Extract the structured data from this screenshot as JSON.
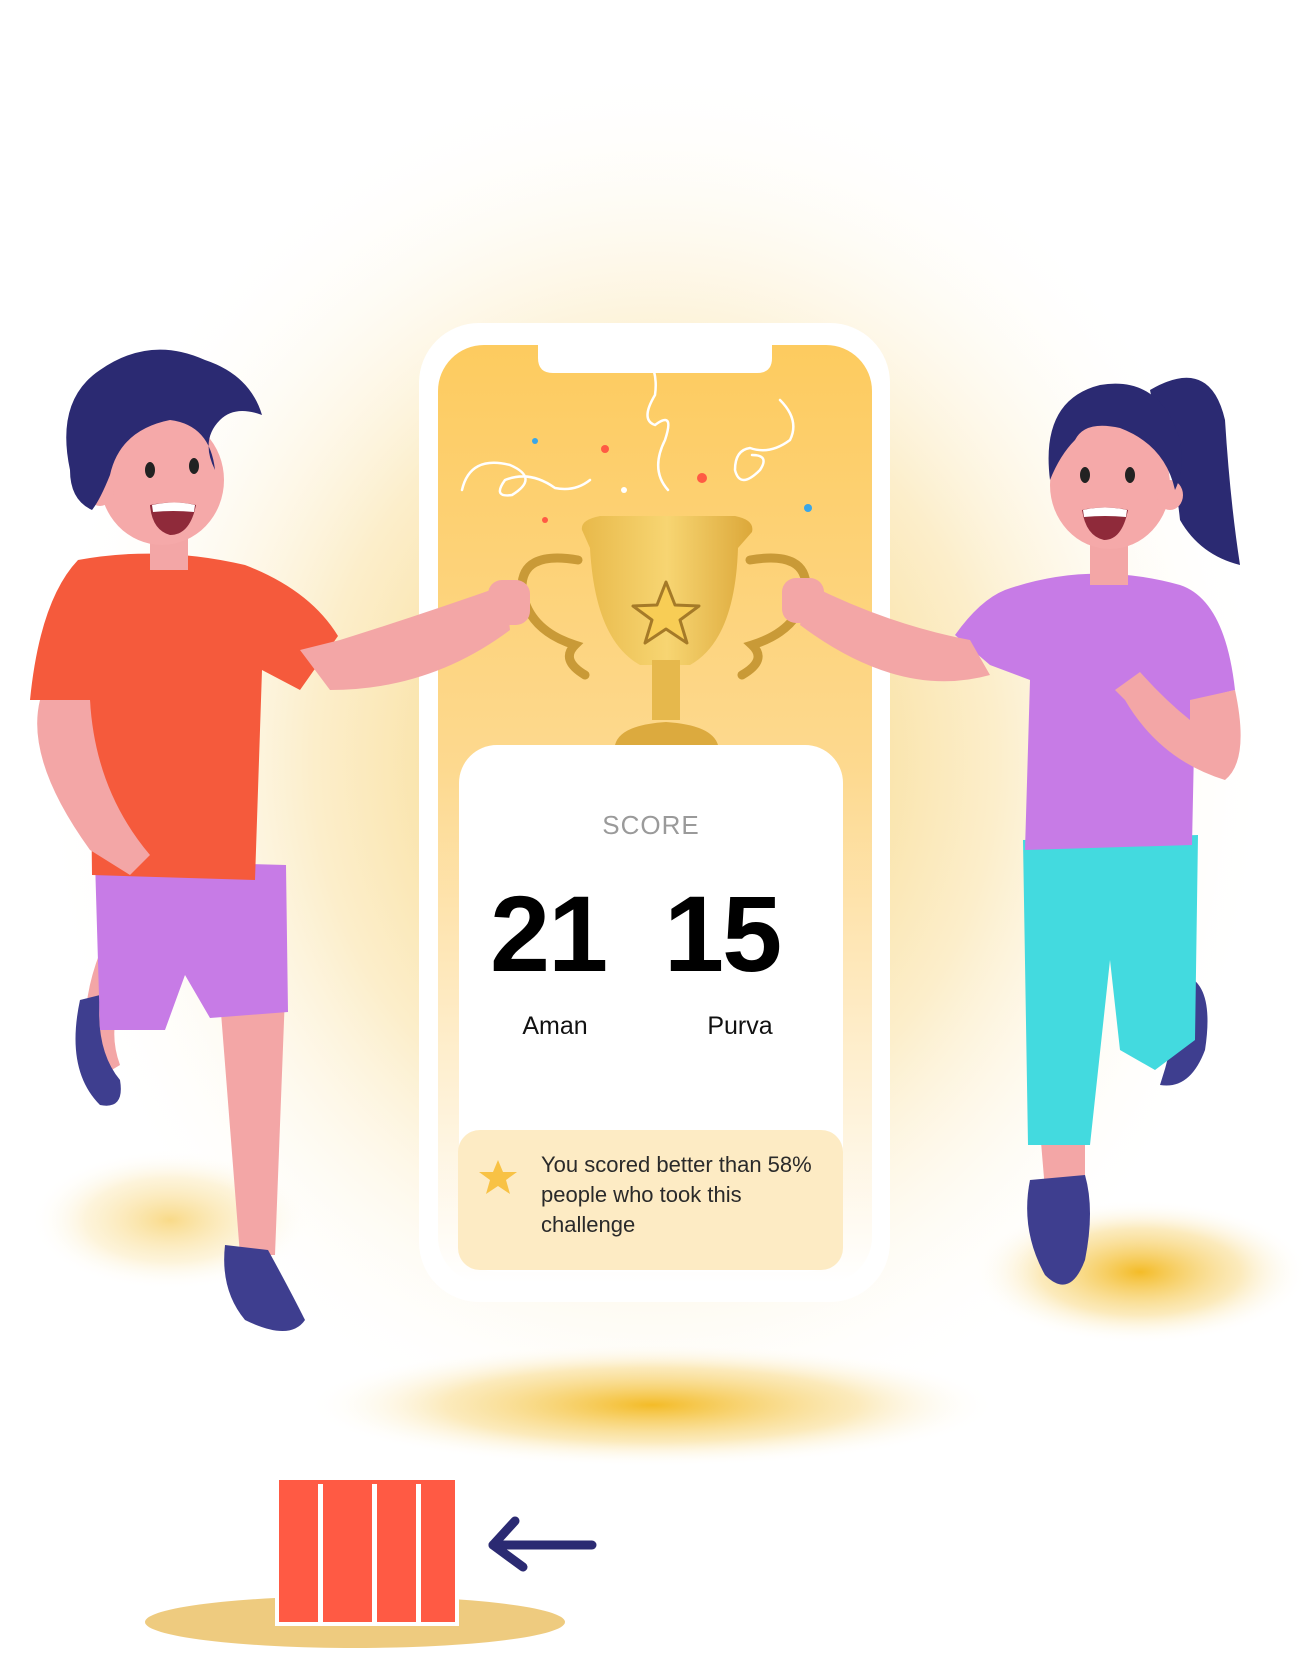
{
  "score_card": {
    "title": "SCORE",
    "players": [
      {
        "name": "Aman",
        "score": "21"
      },
      {
        "name": "Purva",
        "score": "15"
      }
    ],
    "banner": {
      "icon": "star-icon",
      "text": "You scored better than 58% people who took this challenge"
    }
  },
  "colors": {
    "phone_bg": "#fdcd63",
    "banner_bg": "#fdebc4",
    "star": "#f8c245",
    "hurdle": "#ff5a44",
    "arrow": "#2b2a72"
  }
}
